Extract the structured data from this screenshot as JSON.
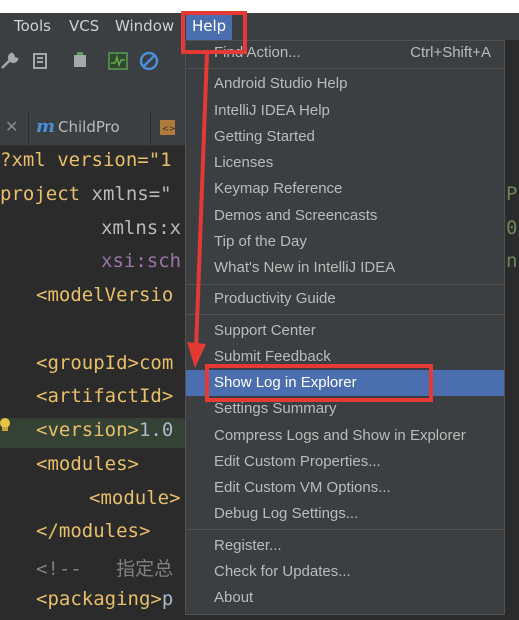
{
  "menubar": {
    "tools": "Tools",
    "vcs": "VCS",
    "window": "Window",
    "help": "Help"
  },
  "tab": {
    "name": "ChildPro",
    "letter": "m"
  },
  "editor": {
    "line1": "?xml version=\"1",
    "line2_tag": "project",
    "line2_attr": " xmlns=\"",
    "line3": "xmlns:x",
    "line4": "xsi:sch",
    "line5": "<modelVersio",
    "line6": "<groupId>com",
    "line7": "<artifactId>",
    "line8_tag": "<version>",
    "line8_txt": "1.0",
    "line9": "<modules>",
    "line10": "<module>",
    "line11": "</modules>",
    "line12": "<!--   指定总",
    "line13_tag": "<packaging>",
    "line13_txt": "p",
    "r1": "P",
    "r2": "0",
    "r3": "n"
  },
  "help_menu": {
    "find_action": "Find Action...",
    "find_action_shortcut": "Ctrl+Shift+A",
    "android_studio_help": "Android Studio Help",
    "intellij_help": "IntelliJ IDEA Help",
    "getting_started": "Getting Started",
    "licenses": "Licenses",
    "keymap_reference": "Keymap Reference",
    "demos": "Demos and Screencasts",
    "tip_of_day": "Tip of the Day",
    "whats_new": "What's New in IntelliJ IDEA",
    "productivity_guide": "Productivity Guide",
    "support_center": "Support Center",
    "submit_feedback": "Submit Feedback",
    "show_log": "Show Log in Explorer",
    "settings_summary": "Settings Summary",
    "compress_logs": "Compress Logs and Show in Explorer",
    "edit_custom_props": "Edit Custom Properties...",
    "edit_custom_vm": "Edit Custom VM Options...",
    "debug_log": "Debug Log Settings...",
    "register": "Register...",
    "check_updates": "Check for Updates...",
    "about": "About"
  },
  "colors": {
    "selection": "#4b6eaf",
    "highlight": "#e53935"
  }
}
